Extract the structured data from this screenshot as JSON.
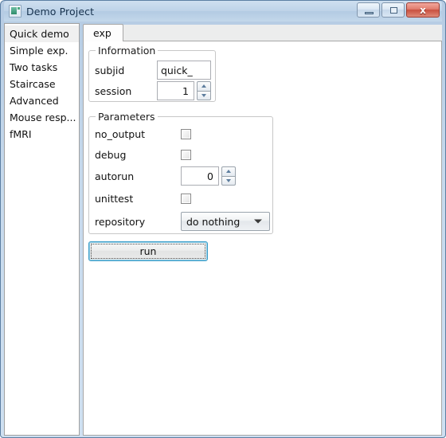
{
  "window": {
    "title": "Demo Project",
    "icon": "app-monitor-icon",
    "controls": {
      "minimize_label": "",
      "maximize_label": "",
      "close_label": "x"
    }
  },
  "sidebar": {
    "items": [
      {
        "label": "Quick demo",
        "selected": true
      },
      {
        "label": "Simple exp.",
        "selected": false
      },
      {
        "label": "Two tasks",
        "selected": false
      },
      {
        "label": "Staircase",
        "selected": false
      },
      {
        "label": "Advanced",
        "selected": false
      },
      {
        "label": "Mouse resp...",
        "selected": false
      },
      {
        "label": "fMRI",
        "selected": false
      }
    ]
  },
  "tabs": [
    {
      "label": "exp",
      "active": true
    }
  ],
  "information": {
    "title": "Information",
    "subjid_label": "subjid",
    "subjid_value": "quick_",
    "session_label": "session",
    "session_value": "1"
  },
  "parameters": {
    "title": "Parameters",
    "no_output_label": "no_output",
    "no_output_checked": false,
    "debug_label": "debug",
    "debug_checked": false,
    "autorun_label": "autorun",
    "autorun_value": "0",
    "unittest_label": "unittest",
    "unittest_checked": false,
    "repository_label": "repository",
    "repository_value": "do nothing"
  },
  "actions": {
    "run_label": "run"
  },
  "colors": {
    "frame": "#c6d9ec",
    "title_text": "#16314d",
    "close_button": "#c8503f",
    "focus_ring": "#3c9ec9",
    "selection": "#f0f0f0"
  }
}
